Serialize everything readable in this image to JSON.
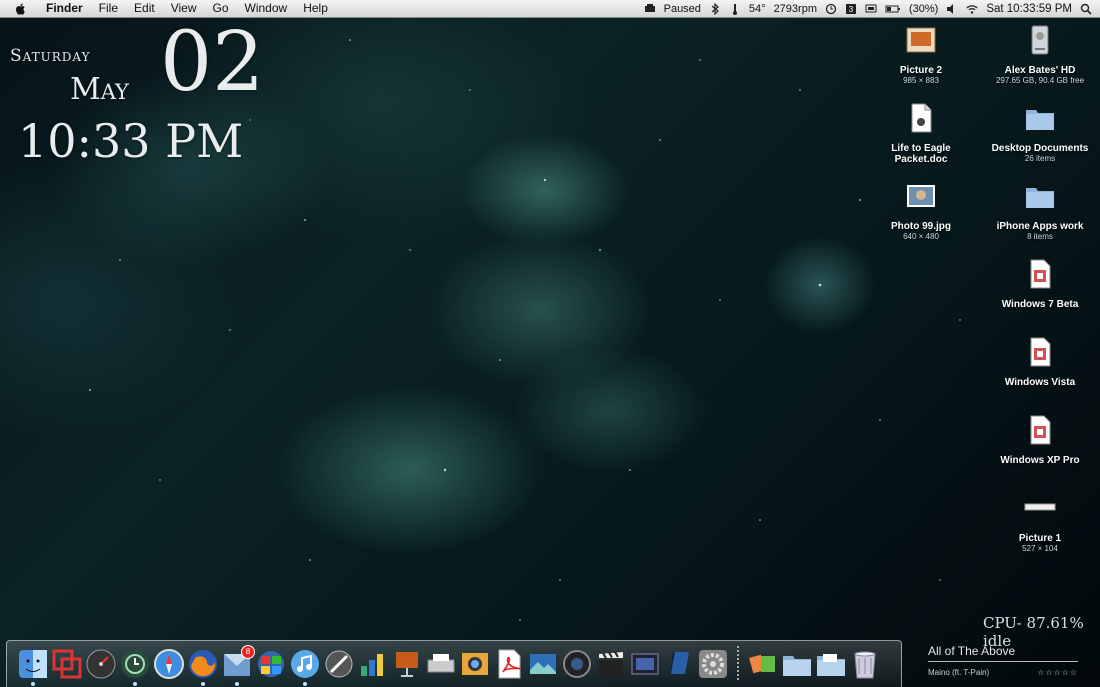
{
  "menubar": {
    "app_name": "Finder",
    "items": [
      "File",
      "Edit",
      "View",
      "Go",
      "Window",
      "Help"
    ],
    "status": {
      "playback": "Paused",
      "temperature": "54°",
      "fan": "2793rpm",
      "battery": "(30%)",
      "clock": "Sat 10:33:59 PM"
    },
    "icons": [
      "apple-icon",
      "playback-icon",
      "bluetooth-icon",
      "temperature-icon",
      "time-machine-icon",
      "script-icon",
      "display-icon",
      "battery-icon",
      "volume-icon",
      "wifi-icon",
      "spotlight-icon"
    ]
  },
  "clock_widget": {
    "day": "Saturday",
    "month": "May",
    "date": "02",
    "time": "10:33 PM"
  },
  "desktop_icons": [
    {
      "name": "Picture 2",
      "sub": "985 × 883",
      "icon": "image-icon"
    },
    {
      "name": "Alex Bates' HD",
      "sub": "297.65 GB, 90.4 GB free",
      "icon": "hard-drive-icon"
    },
    {
      "name": "Life to Eagle Packet.doc",
      "sub": "",
      "icon": "document-icon"
    },
    {
      "name": "Desktop Documents",
      "sub": "26 items",
      "icon": "folder-icon"
    },
    {
      "name": "Photo 99.jpg",
      "sub": "640 × 480",
      "icon": "photo-icon"
    },
    {
      "name": "iPhone Apps work",
      "sub": "8 items",
      "icon": "folder-icon"
    },
    {
      "name": "Windows 7 Beta",
      "sub": "",
      "icon": "vm-icon"
    },
    {
      "name": "Windows Vista",
      "sub": "",
      "icon": "vm-icon"
    },
    {
      "name": "Windows XP Pro",
      "sub": "",
      "icon": "vm-icon"
    },
    {
      "name": "Picture 1",
      "sub": "527 × 104",
      "icon": "image-icon"
    }
  ],
  "cpu": {
    "text": "CPU- 87.61% idle"
  },
  "dock": {
    "badge": "8",
    "apps": [
      "finder-icon",
      "parallels-icon",
      "dashboard-icon",
      "time-machine-icon",
      "safari-icon",
      "firefox-icon",
      "mail-icon",
      "chat-icon",
      "itunes-icon",
      "app-icon",
      "numbers-icon",
      "keynote-icon",
      "printer-icon",
      "iphoto-icon",
      "acrobat-icon",
      "preview-icon",
      "camera-icon",
      "clapper-icon",
      "film-icon",
      "book-icon",
      "system-preferences-icon"
    ],
    "stacks": [
      "applications-stack-icon",
      "folder-stack-icon",
      "folder-stack-icon",
      "trash-icon"
    ]
  },
  "now_playing": {
    "title": "All of The Above",
    "artist": "Maino (ft. T-Pain)",
    "rating": "☆☆☆☆☆"
  }
}
